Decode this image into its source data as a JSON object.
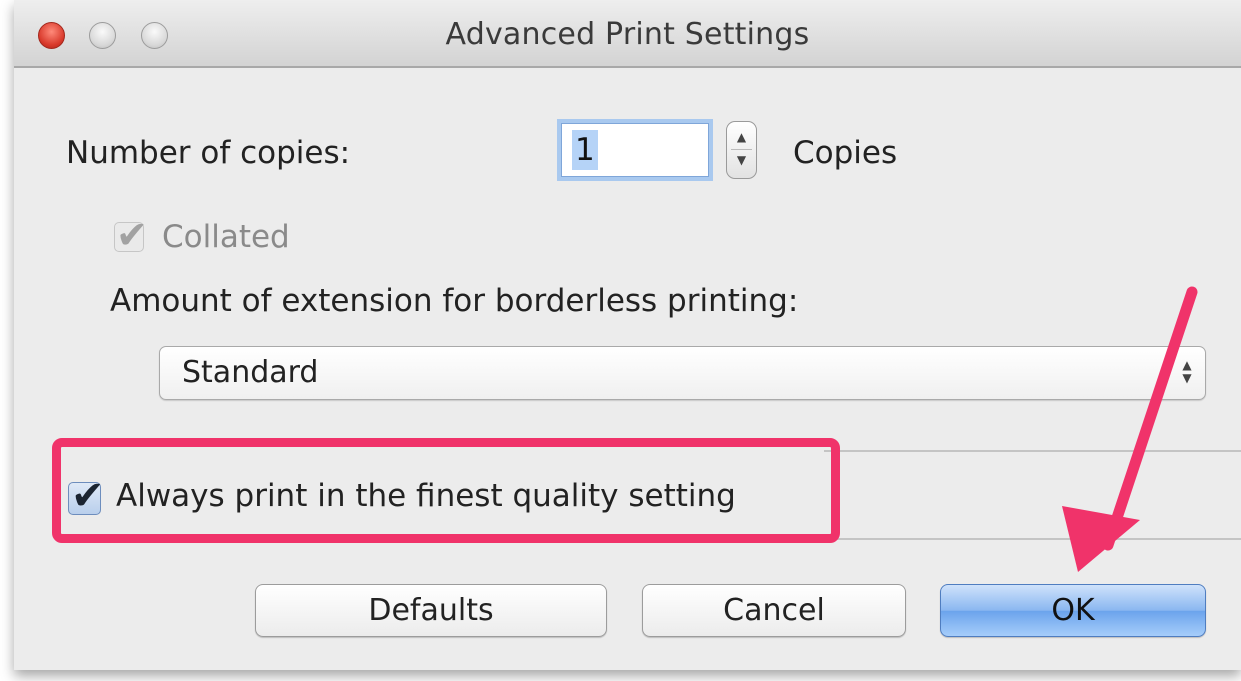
{
  "window": {
    "title": "Advanced Print Settings"
  },
  "copies": {
    "label": "Number of copies:",
    "value": "1",
    "unit": "Copies"
  },
  "collated": {
    "label": "Collated",
    "checked": true,
    "enabled": false
  },
  "extension": {
    "label": "Amount of extension for borderless printing:",
    "selected": "Standard"
  },
  "finest_quality": {
    "label": "Always print in the finest quality setting",
    "checked": true
  },
  "buttons": {
    "defaults": "Defaults",
    "cancel": "Cancel",
    "ok": "OK"
  },
  "colors": {
    "highlight": "#f0336a",
    "default_button": "#6ba3ec"
  },
  "icons": {
    "checkmark": "✔",
    "stepper_up": "▲",
    "stepper_down": "▼",
    "select_up": "▲",
    "select_down": "▼"
  }
}
